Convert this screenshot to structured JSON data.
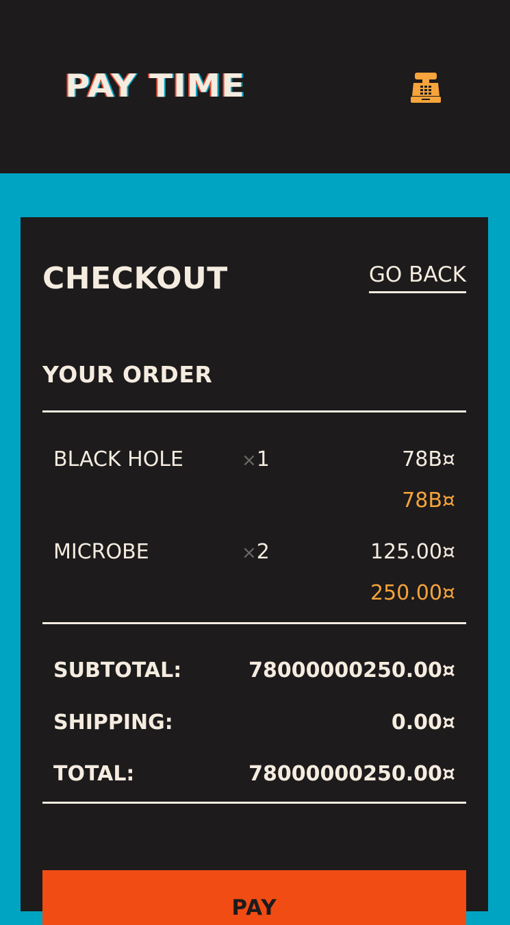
{
  "header": {
    "logo_text": "PAY TIME",
    "icon": "cash-register-icon",
    "icon_color": "#f6a43b"
  },
  "checkout": {
    "title": "CHECKOUT",
    "back_label": "GO BACK",
    "order_title": "YOUR ORDER",
    "items": [
      {
        "name": "BLACK HOLE",
        "qty_symbol": "×",
        "qty": "1",
        "price": "78B¤",
        "line_total": "78B¤"
      },
      {
        "name": "MICROBE",
        "qty_symbol": "×",
        "qty": "2",
        "price": "125.00¤",
        "line_total": "250.00¤"
      }
    ],
    "summary": {
      "subtotal_label": "SUBTOTAL:",
      "subtotal_value": "78000000250.00¤",
      "shipping_label": "SHIPPING:",
      "shipping_value": "0.00¤",
      "total_label": "TOTAL:",
      "total_value": "78000000250.00¤"
    },
    "pay_label": "PAY"
  },
  "colors": {
    "background": "#00a4c3",
    "panel": "#1d1b1c",
    "text": "#f5ece0",
    "accent": "#f6a43b",
    "button": "#f04c14"
  }
}
